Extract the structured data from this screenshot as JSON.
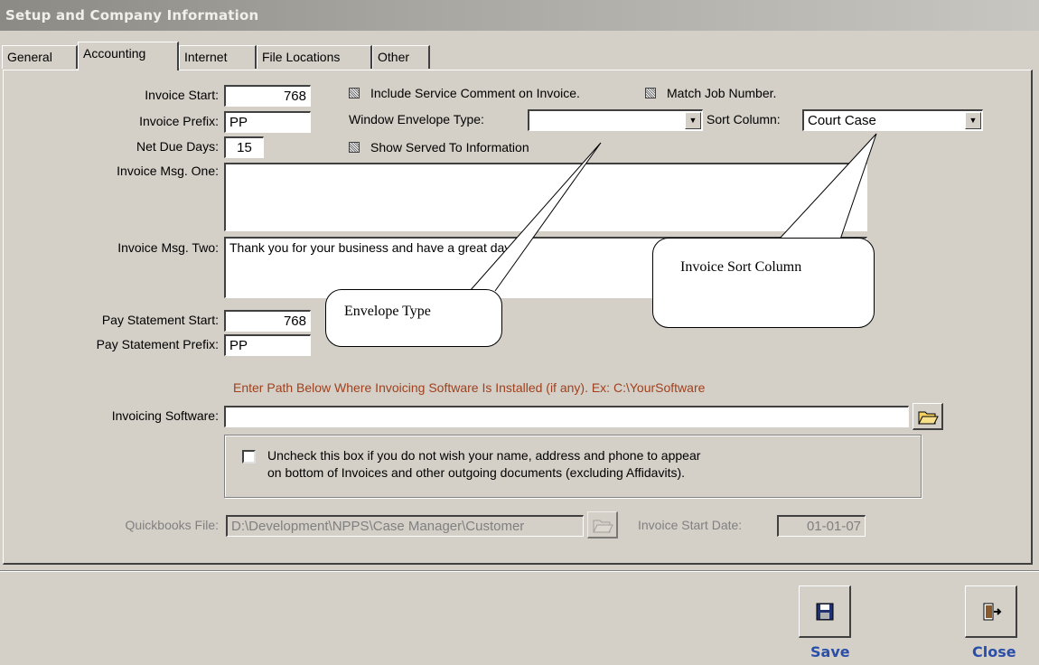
{
  "window": {
    "title": "Setup and Company Information"
  },
  "tabs": [
    "General",
    "Accounting",
    "Internet",
    "File Locations",
    "Other"
  ],
  "accounting": {
    "invoice_start_label": "Invoice Start:",
    "invoice_start": "768",
    "invoice_prefix_label": "Invoice Prefix:",
    "invoice_prefix": "PP",
    "net_due_days_label": "Net Due Days:",
    "net_due_days": "15",
    "include_service_comment_label": "Include Service Comment on Invoice.",
    "match_job_number_label": "Match Job Number.",
    "window_envelope_type_label": "Window Envelope Type:",
    "window_envelope_type": "",
    "sort_column_label": "Sort Column:",
    "sort_column": "Court Case",
    "show_served_to_label": "Show Served To Information",
    "invoice_msg_one_label": "Invoice Msg. One:",
    "invoice_msg_one": "",
    "invoice_msg_two_label": "Invoice Msg. Two:",
    "invoice_msg_two": "Thank you for your business and have a great day!",
    "pay_statement_start_label": "Pay Statement Start:",
    "pay_statement_start": "768",
    "pay_statement_prefix_label": "Pay Statement Prefix:",
    "pay_statement_prefix": "PP",
    "path_hint": "Enter Path Below Where Invoicing Software Is Installed (if any). Ex: C:\\YourSoftware",
    "invoicing_software_label": "Invoicing Software:",
    "invoicing_software": "",
    "uncheck_line1": "Uncheck this box if you do not wish your name, address and phone to appear",
    "uncheck_line2": "on bottom of Invoices and other outgoing documents (excluding Affidavits).",
    "quickbooks_file_label": "Quickbooks File:",
    "quickbooks_file": "D:\\Development\\NPPS\\Case Manager\\Customer",
    "invoice_start_date_label": "Invoice Start Date:",
    "invoice_start_date": "01-01-07"
  },
  "callouts": {
    "envelope_type": "Envelope Type",
    "invoice_sort_column": "Invoice Sort Column"
  },
  "buttons": {
    "save": "Save",
    "close": "Close"
  },
  "colors": {
    "hint_text": "#a0401c",
    "button_label": "#2b4fa8"
  }
}
